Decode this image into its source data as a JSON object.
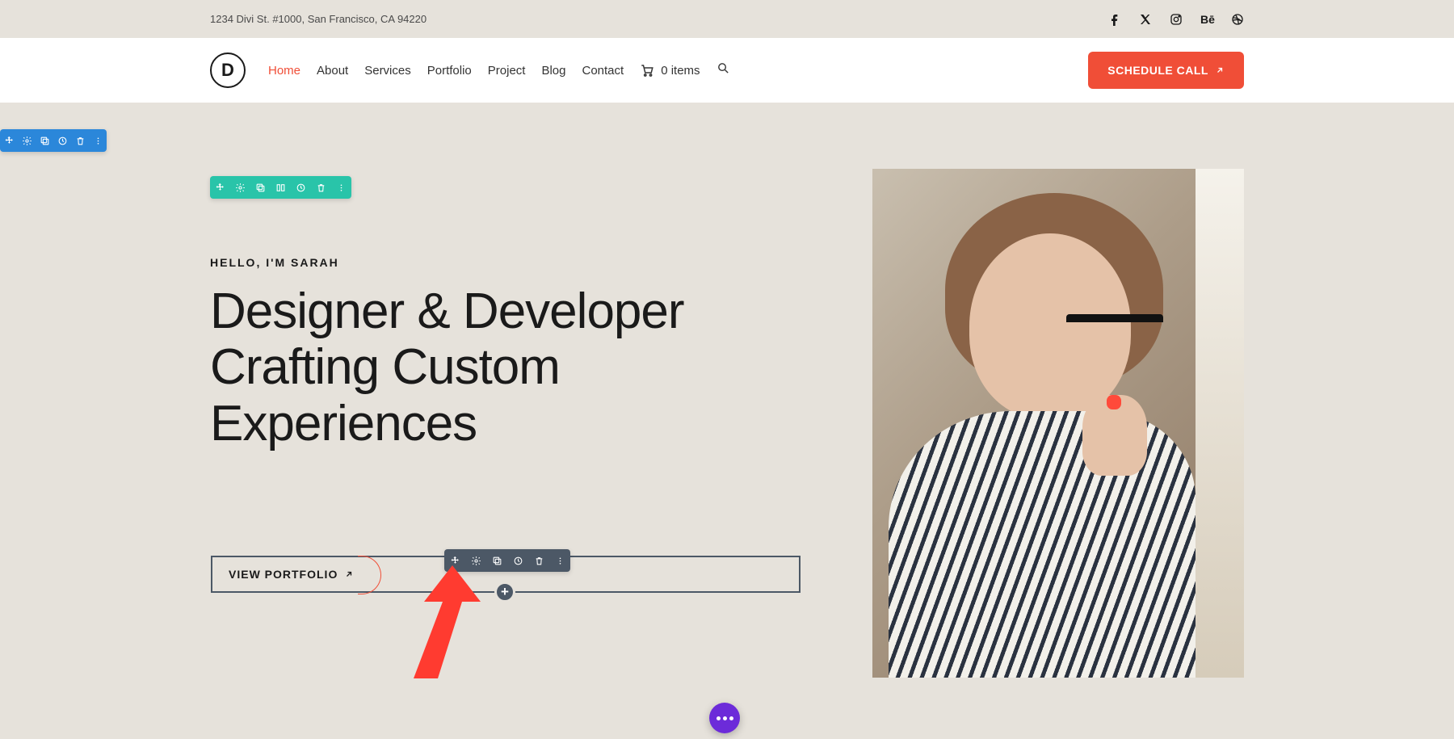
{
  "topbar": {
    "address": "1234 Divi St. #1000, San Francisco, CA 94220",
    "social": [
      "facebook",
      "x-twitter",
      "instagram",
      "behance",
      "dribbble"
    ]
  },
  "nav": {
    "logo_letter": "D",
    "links": [
      {
        "label": "Home",
        "active": true
      },
      {
        "label": "About",
        "active": false
      },
      {
        "label": "Services",
        "active": false
      },
      {
        "label": "Portfolio",
        "active": false
      },
      {
        "label": "Project",
        "active": false
      },
      {
        "label": "Blog",
        "active": false
      },
      {
        "label": "Contact",
        "active": false
      }
    ],
    "cart_label": "0 items",
    "cta_label": "SCHEDULE CALL"
  },
  "hero": {
    "eyebrow": "HELLO, I'M SARAH",
    "headline": "Designer & Developer Crafting Custom Experiences",
    "button_label": "VIEW PORTFOLIO"
  },
  "builder": {
    "section_toolbar": [
      "move",
      "settings",
      "duplicate",
      "save",
      "delete",
      "more"
    ],
    "row_toolbar": [
      "move",
      "settings",
      "duplicate",
      "columns",
      "save",
      "delete",
      "more"
    ],
    "module_toolbar": [
      "move",
      "settings",
      "duplicate",
      "save",
      "delete",
      "more"
    ],
    "add_label": "+"
  },
  "colors": {
    "accent": "#f04e37",
    "section": "#2b87da",
    "row": "#29c4a9",
    "module": "#4c5866",
    "fab": "#6c2bd9"
  }
}
